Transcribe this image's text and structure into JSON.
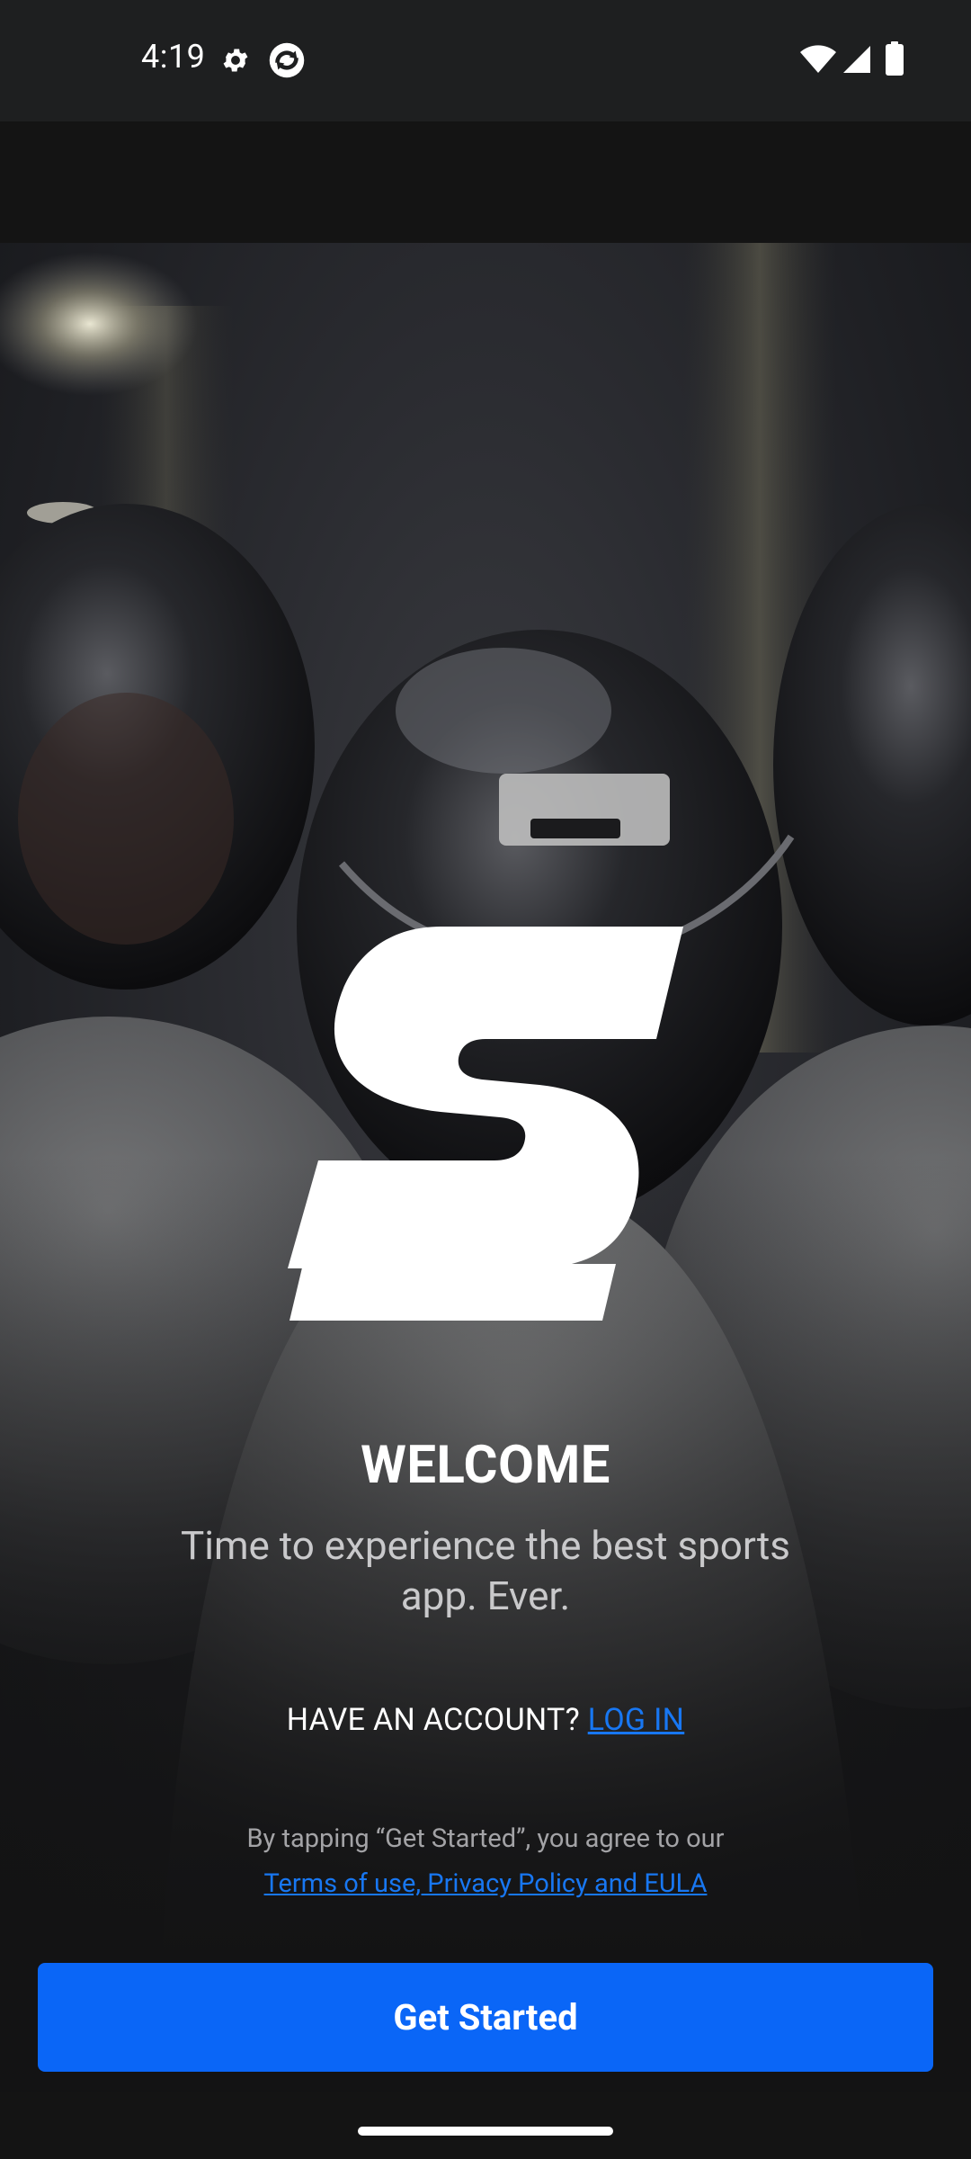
{
  "status_bar": {
    "time": "4:19",
    "icons_left": [
      "gear-icon",
      "sync-app-icon"
    ],
    "icons_right": [
      "wifi-icon",
      "signal-icon",
      "battery-icon"
    ]
  },
  "brand": {
    "logo_icon": "theScore-s-logo-icon",
    "accent_color": "#0a66f7",
    "link_color": "#1877f2"
  },
  "welcome": {
    "title": "WELCOME",
    "subtitle": "Time to experience the best sports app. Ever."
  },
  "account": {
    "prompt": "HAVE AN ACCOUNT?",
    "login_label": "LOG IN"
  },
  "terms": {
    "intro": "By tapping “Get Started”, you agree to our",
    "link_label": "Terms of use, Privacy Policy and EULA"
  },
  "cta": {
    "get_started_label": "Get Started"
  }
}
